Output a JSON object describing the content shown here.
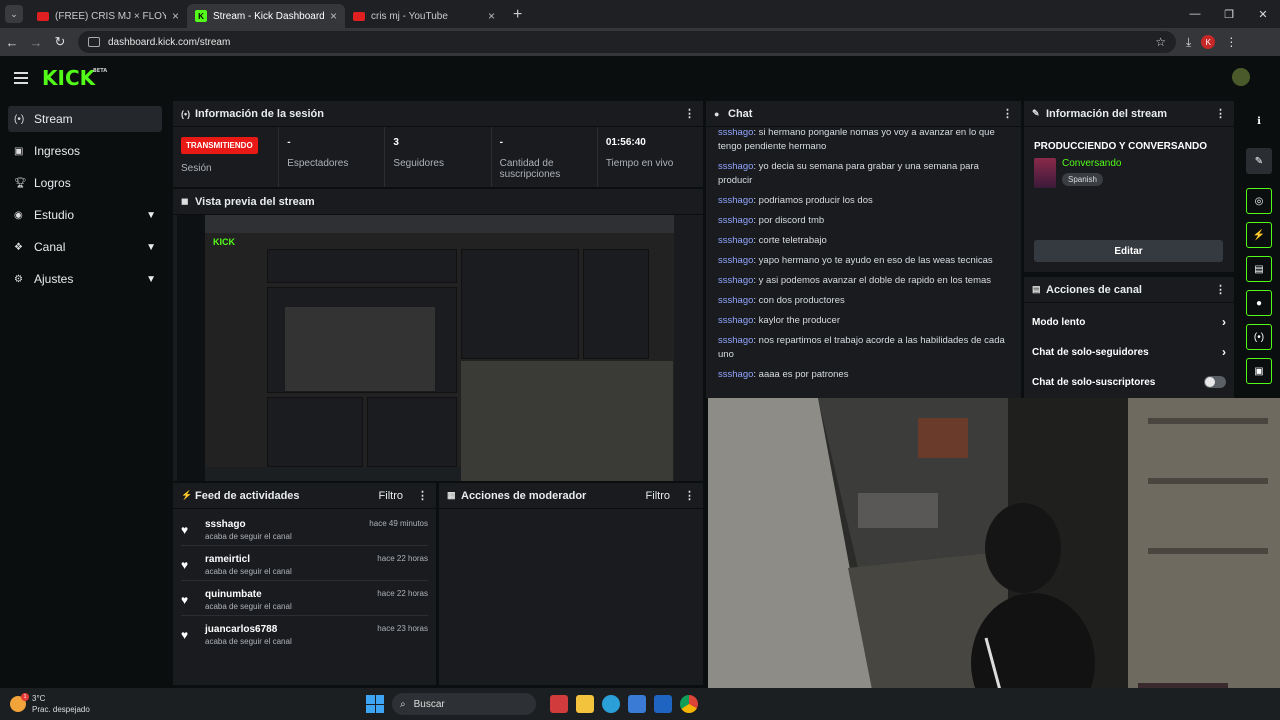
{
  "browser": {
    "tabs": [
      {
        "title": "(FREE) CRIS MJ × FLOYY MENOR",
        "active": false
      },
      {
        "title": "Stream - Kick Dashboard",
        "active": true
      },
      {
        "title": "cris mj - YouTube",
        "active": false
      }
    ],
    "url": "dashboard.kick.com/stream",
    "profile_initial": "K"
  },
  "kick": {
    "logo": "KICK",
    "logo_badge": "BETA"
  },
  "sidebar": {
    "items": [
      {
        "label": "Stream",
        "icon": "broadcast-icon",
        "active": true
      },
      {
        "label": "Ingresos",
        "icon": "wallet-icon"
      },
      {
        "label": "Logros",
        "icon": "trophy-icon"
      },
      {
        "label": "Estudio",
        "icon": "studio-icon",
        "expandable": true
      },
      {
        "label": "Canal",
        "icon": "channel-icon",
        "expandable": true
      },
      {
        "label": "Ajustes",
        "icon": "gear-icon",
        "expandable": true
      }
    ]
  },
  "session": {
    "title": "Información de la sesión",
    "status_badge": "TRANSMITIENDO",
    "status_label": "Sesión",
    "spectators_value": "-",
    "spectators_label": "Espectadores",
    "followers_value": "3",
    "followers_label": "Seguidores",
    "subs_value": "-",
    "subs_label": "Cantidad de suscripciones",
    "uptime_value": "01:56:40",
    "uptime_label": "Tiempo en vivo"
  },
  "preview": {
    "title": "Vista previa del stream"
  },
  "chat": {
    "title": "Chat",
    "messages": [
      {
        "user": "ssshago",
        "text": "si hermano ponganle nomas yo voy a avanzar en lo que tengo pendiente hermano"
      },
      {
        "user": "ssshago",
        "text": "yo decia su semana para grabar y una semana para producir"
      },
      {
        "user": "ssshago",
        "text": "podriamos producir los dos"
      },
      {
        "user": "ssshago",
        "text": "por discord tmb"
      },
      {
        "user": "ssshago",
        "text": "corte teletrabajo"
      },
      {
        "user": "ssshago",
        "text": "yapo hermano yo te ayudo en eso de las weas tecnicas"
      },
      {
        "user": "ssshago",
        "text": "y asi podemos avanzar el doble de rapido en los temas"
      },
      {
        "user": "ssshago",
        "text": "con dos productores"
      },
      {
        "user": "ssshago",
        "text": "kaylor the producer"
      },
      {
        "user": "ssshago",
        "text": "nos repartimos el trabajo acorde a las habilidades de cada uno"
      },
      {
        "user": "ssshago",
        "text": "aaaa es por patrones"
      }
    ]
  },
  "stream_info": {
    "title": "Información del stream",
    "stream_title": "PRODUCCIENDO Y CONVERSANDO",
    "category": "Conversando",
    "tag": "Spanish",
    "edit_label": "Editar"
  },
  "channel_actions": {
    "title": "Acciones de canal",
    "items": [
      {
        "label": "Modo lento",
        "type": "chevron"
      },
      {
        "label": "Chat de solo-seguidores",
        "type": "chevron"
      },
      {
        "label": "Chat de solo-suscriptores",
        "type": "toggle"
      }
    ]
  },
  "feed": {
    "title": "Feed de actividades",
    "filter_label": "Filtro",
    "items": [
      {
        "name": "ssshago",
        "action": "acaba de seguir el canal",
        "time": "hace 49 minutos"
      },
      {
        "name": "rameirticl",
        "action": "acaba de seguir el canal",
        "time": "hace 22 horas"
      },
      {
        "name": "quinumbate",
        "action": "acaba de seguir el canal",
        "time": "hace 22 horas"
      },
      {
        "name": "juancarlos6788",
        "action": "acaba de seguir el canal",
        "time": "hace 23 horas"
      }
    ]
  },
  "moderator": {
    "title": "Acciones de moderador",
    "filter_label": "Filtro"
  },
  "taskbar": {
    "temperature": "3°C",
    "weather": "Prac. despejado",
    "search_placeholder": "Buscar",
    "notification_count": "1"
  },
  "colors": {
    "accent": "#53fc18",
    "live_badge": "#e91916",
    "username": "#92a6ff",
    "panel_bg": "#191b1f",
    "page_bg": "#0b0e0f"
  }
}
